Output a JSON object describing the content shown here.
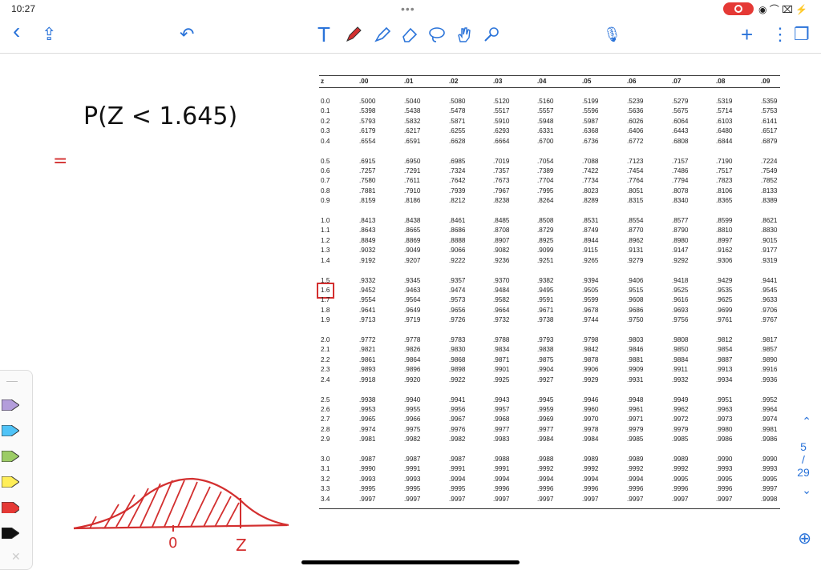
{
  "status": {
    "time": "10:27",
    "dots": "•••",
    "icons": "◉ ⌒ ⌧ ⚡"
  },
  "toolbar": {
    "back": "‹",
    "share": "⇪",
    "undo": "↶",
    "text_tool": "T",
    "mic": "🎙",
    "add": "+",
    "more": "⋮",
    "pages": "❐"
  },
  "handwriting": {
    "prob": "P(Z < 1.645)",
    "equals": "=",
    "zero": "0",
    "z": "Z"
  },
  "z_table": {
    "headers": [
      "z",
      ".00",
      ".01",
      ".02",
      ".03",
      ".04",
      ".05",
      ".06",
      ".07",
      ".08",
      ".09"
    ],
    "rows": [
      [
        "0.0",
        ".5000",
        ".5040",
        ".5080",
        ".5120",
        ".5160",
        ".5199",
        ".5239",
        ".5279",
        ".5319",
        ".5359"
      ],
      [
        "0.1",
        ".5398",
        ".5438",
        ".5478",
        ".5517",
        ".5557",
        ".5596",
        ".5636",
        ".5675",
        ".5714",
        ".5753"
      ],
      [
        "0.2",
        ".5793",
        ".5832",
        ".5871",
        ".5910",
        ".5948",
        ".5987",
        ".6026",
        ".6064",
        ".6103",
        ".6141"
      ],
      [
        "0.3",
        ".6179",
        ".6217",
        ".6255",
        ".6293",
        ".6331",
        ".6368",
        ".6406",
        ".6443",
        ".6480",
        ".6517"
      ],
      [
        "0.4",
        ".6554",
        ".6591",
        ".6628",
        ".6664",
        ".6700",
        ".6736",
        ".6772",
        ".6808",
        ".6844",
        ".6879"
      ],
      [
        "0.5",
        ".6915",
        ".6950",
        ".6985",
        ".7019",
        ".7054",
        ".7088",
        ".7123",
        ".7157",
        ".7190",
        ".7224"
      ],
      [
        "0.6",
        ".7257",
        ".7291",
        ".7324",
        ".7357",
        ".7389",
        ".7422",
        ".7454",
        ".7486",
        ".7517",
        ".7549"
      ],
      [
        "0.7",
        ".7580",
        ".7611",
        ".7642",
        ".7673",
        ".7704",
        ".7734",
        ".7764",
        ".7794",
        ".7823",
        ".7852"
      ],
      [
        "0.8",
        ".7881",
        ".7910",
        ".7939",
        ".7967",
        ".7995",
        ".8023",
        ".8051",
        ".8078",
        ".8106",
        ".8133"
      ],
      [
        "0.9",
        ".8159",
        ".8186",
        ".8212",
        ".8238",
        ".8264",
        ".8289",
        ".8315",
        ".8340",
        ".8365",
        ".8389"
      ],
      [
        "1.0",
        ".8413",
        ".8438",
        ".8461",
        ".8485",
        ".8508",
        ".8531",
        ".8554",
        ".8577",
        ".8599",
        ".8621"
      ],
      [
        "1.1",
        ".8643",
        ".8665",
        ".8686",
        ".8708",
        ".8729",
        ".8749",
        ".8770",
        ".8790",
        ".8810",
        ".8830"
      ],
      [
        "1.2",
        ".8849",
        ".8869",
        ".8888",
        ".8907",
        ".8925",
        ".8944",
        ".8962",
        ".8980",
        ".8997",
        ".9015"
      ],
      [
        "1.3",
        ".9032",
        ".9049",
        ".9066",
        ".9082",
        ".9099",
        ".9115",
        ".9131",
        ".9147",
        ".9162",
        ".9177"
      ],
      [
        "1.4",
        ".9192",
        ".9207",
        ".9222",
        ".9236",
        ".9251",
        ".9265",
        ".9279",
        ".9292",
        ".9306",
        ".9319"
      ],
      [
        "1.5",
        ".9332",
        ".9345",
        ".9357",
        ".9370",
        ".9382",
        ".9394",
        ".9406",
        ".9418",
        ".9429",
        ".9441"
      ],
      [
        "1.6",
        ".9452",
        ".9463",
        ".9474",
        ".9484",
        ".9495",
        ".9505",
        ".9515",
        ".9525",
        ".9535",
        ".9545"
      ],
      [
        "1.7",
        ".9554",
        ".9564",
        ".9573",
        ".9582",
        ".9591",
        ".9599",
        ".9608",
        ".9616",
        ".9625",
        ".9633"
      ],
      [
        "1.8",
        ".9641",
        ".9649",
        ".9656",
        ".9664",
        ".9671",
        ".9678",
        ".9686",
        ".9693",
        ".9699",
        ".9706"
      ],
      [
        "1.9",
        ".9713",
        ".9719",
        ".9726",
        ".9732",
        ".9738",
        ".9744",
        ".9750",
        ".9756",
        ".9761",
        ".9767"
      ],
      [
        "2.0",
        ".9772",
        ".9778",
        ".9783",
        ".9788",
        ".9793",
        ".9798",
        ".9803",
        ".9808",
        ".9812",
        ".9817"
      ],
      [
        "2.1",
        ".9821",
        ".9826",
        ".9830",
        ".9834",
        ".9838",
        ".9842",
        ".9846",
        ".9850",
        ".9854",
        ".9857"
      ],
      [
        "2.2",
        ".9861",
        ".9864",
        ".9868",
        ".9871",
        ".9875",
        ".9878",
        ".9881",
        ".9884",
        ".9887",
        ".9890"
      ],
      [
        "2.3",
        ".9893",
        ".9896",
        ".9898",
        ".9901",
        ".9904",
        ".9906",
        ".9909",
        ".9911",
        ".9913",
        ".9916"
      ],
      [
        "2.4",
        ".9918",
        ".9920",
        ".9922",
        ".9925",
        ".9927",
        ".9929",
        ".9931",
        ".9932",
        ".9934",
        ".9936"
      ],
      [
        "2.5",
        ".9938",
        ".9940",
        ".9941",
        ".9943",
        ".9945",
        ".9946",
        ".9948",
        ".9949",
        ".9951",
        ".9952"
      ],
      [
        "2.6",
        ".9953",
        ".9955",
        ".9956",
        ".9957",
        ".9959",
        ".9960",
        ".9961",
        ".9962",
        ".9963",
        ".9964"
      ],
      [
        "2.7",
        ".9965",
        ".9966",
        ".9967",
        ".9968",
        ".9969",
        ".9970",
        ".9971",
        ".9972",
        ".9973",
        ".9974"
      ],
      [
        "2.8",
        ".9974",
        ".9975",
        ".9976",
        ".9977",
        ".9977",
        ".9978",
        ".9979",
        ".9979",
        ".9980",
        ".9981"
      ],
      [
        "2.9",
        ".9981",
        ".9982",
        ".9982",
        ".9983",
        ".9984",
        ".9984",
        ".9985",
        ".9985",
        ".9986",
        ".9986"
      ],
      [
        "3.0",
        ".9987",
        ".9987",
        ".9987",
        ".9988",
        ".9988",
        ".9989",
        ".9989",
        ".9989",
        ".9990",
        ".9990"
      ],
      [
        "3.1",
        ".9990",
        ".9991",
        ".9991",
        ".9991",
        ".9992",
        ".9992",
        ".9992",
        ".9992",
        ".9993",
        ".9993"
      ],
      [
        "3.2",
        ".9993",
        ".9993",
        ".9994",
        ".9994",
        ".9994",
        ".9994",
        ".9994",
        ".9995",
        ".9995",
        ".9995"
      ],
      [
        "3.3",
        ".9995",
        ".9995",
        ".9995",
        ".9996",
        ".9996",
        ".9996",
        ".9996",
        ".9996",
        ".9996",
        ".9997"
      ],
      [
        "3.4",
        ".9997",
        ".9997",
        ".9997",
        ".9997",
        ".9997",
        ".9997",
        ".9997",
        ".9997",
        ".9997",
        ".9998"
      ]
    ]
  },
  "pagination": {
    "up": "⌃",
    "current": "5",
    "sep": "/",
    "total": "29",
    "down": "⌄"
  },
  "zoom_icon": "⊕",
  "palette": {
    "grip": "—",
    "close": "✕"
  }
}
